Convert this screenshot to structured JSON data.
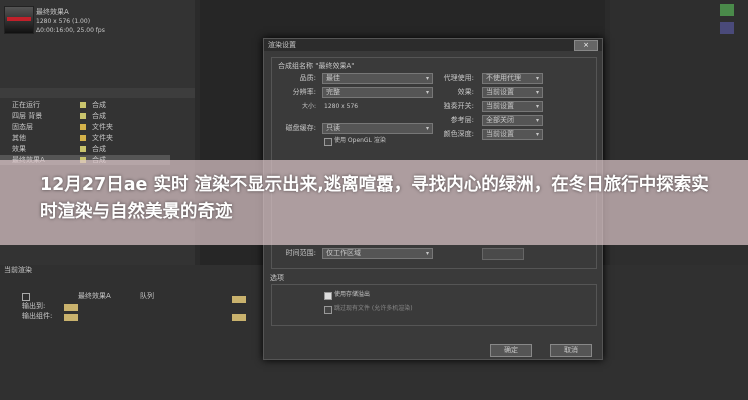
{
  "headline": "12月27日ae 实时 渲染不显示出来,逃离喧嚣，寻找内心的绿洲，在冬日旅行中探索实时渲染与自然美景的奇迹",
  "project": {
    "comp_name": "最终效果A",
    "comp_info1": "1280 x 576 (1.00)",
    "comp_info2": "Δ0:00:16:00, 25.00 fps",
    "rows": [
      {
        "name": "正在运行",
        "type": "合成",
        "selected": false
      },
      {
        "name": "四层 背景",
        "type": "合成",
        "selected": false
      },
      {
        "name": "固态层",
        "type": "文件夹",
        "selected": false
      },
      {
        "name": "其他",
        "type": "文件夹",
        "selected": false
      },
      {
        "name": "效果",
        "type": "合成",
        "selected": false
      },
      {
        "name": "最终效果A",
        "type": "合成",
        "selected": true
      }
    ]
  },
  "timeline": {
    "tab": "当前渲染",
    "rows": [
      {
        "name": "最终效果A",
        "status": "队列"
      },
      {
        "name": "输出到:",
        "status": ""
      },
      {
        "name": "输出组件:",
        "status": ""
      }
    ]
  },
  "dialog": {
    "title": "渲染设置",
    "close": "×",
    "comp_label": "合成组名称 \"最终效果A\"",
    "quality_label": "品质:",
    "quality_value": "最佳",
    "resolution_label": "分辨率:",
    "resolution_value": "完整",
    "size_label": "大小:",
    "size_value": "1280 x 576",
    "disk_cache_label": "磁盘缓存:",
    "disk_cache_value": "只读",
    "opengl_label": "使用 OpenGL 渲染",
    "proxy_label": "代理使用:",
    "proxy_value": "不使用代理",
    "effects_label": "效果:",
    "effects_value": "当前设置",
    "solo_label": "独奏开关:",
    "solo_value": "当前设置",
    "guide_label": "参考层:",
    "guide_value": "全部关闭",
    "color_label": "颜色深度:",
    "color_value": "当前设置",
    "time_span_label": "时间范围:",
    "time_span_value": "仅工作区域",
    "options_title": "选项",
    "use_storage": "使用存储溢出",
    "skip_existing": "跳过现有文件 (允许多机渲染)",
    "ok": "确定",
    "cancel": "取消"
  }
}
